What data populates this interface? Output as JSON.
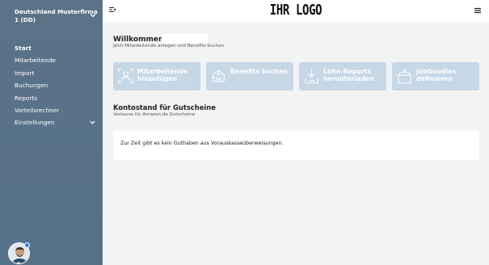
{
  "sidebar": {
    "company": "Deutschland Musterfirma 1 (DD)",
    "items": [
      {
        "label": "Start"
      },
      {
        "label": "Mitarbeitende"
      },
      {
        "label": "Import"
      },
      {
        "label": "Buchungen"
      },
      {
        "label": "Reports"
      },
      {
        "label": "Vorteilsrechner"
      },
      {
        "label": "Einstellungen"
      }
    ]
  },
  "header": {
    "logo": "IHR LOGO"
  },
  "main": {
    "welcome": "Willkommen",
    "welcome_sub": "Jetzt Mitarbeitende anlegen und Benefits buchen.",
    "tiles": [
      {
        "label": "Mitarbeitende hinzufügen",
        "icon": "add-employee-icon"
      },
      {
        "label": "Benefits buchen",
        "icon": "gift-icon"
      },
      {
        "label": "Lohn-Reports herunterladen",
        "icon": "download-report-icon"
      },
      {
        "label": "JobGoodies definieren",
        "icon": "goodies-box-icon"
      }
    ],
    "balance_title": "Kontostand für Gutscheine",
    "balance_sub": "Vorkasse für Amazon.de Gutscheine",
    "balance_message": "Zur Zeit gibt es kein Guthaben aus Vorauskasseüberweisungen."
  },
  "colors": {
    "sidebar": "#5b7388",
    "tile": "#c6d7e6",
    "background": "#f2f3f5"
  }
}
